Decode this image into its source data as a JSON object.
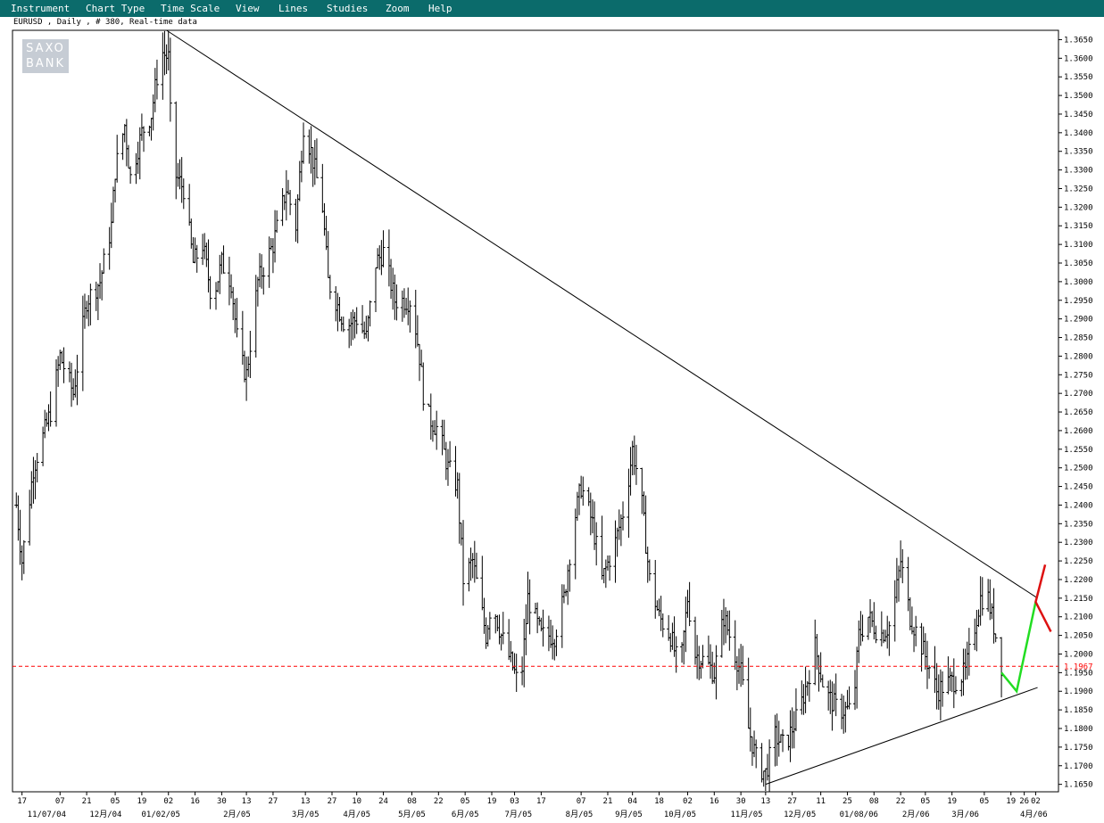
{
  "menu": [
    "Instrument",
    "Chart Type",
    "Time Scale",
    "View",
    "Lines",
    "Studies",
    "Zoom",
    "Help"
  ],
  "subtitle": "EURUSD , Daily , # 380, Real-time data",
  "logo": {
    "line1": "SAXO",
    "line2": "BANK"
  },
  "colors": {
    "menubar": "#0b6b6b",
    "up_arrow": "#22dd22",
    "down_arrow": "#dd1111",
    "price_line": "#ff0000"
  },
  "chart_data": {
    "type": "bar",
    "style": "ohlc",
    "instrument": "EURUSD",
    "timeframe": "Daily",
    "ylim": [
      1.163,
      1.3675
    ],
    "y_ticks": [
      "1.3650",
      "1.3600",
      "1.3550",
      "1.3500",
      "1.3450",
      "1.3400",
      "1.3350",
      "1.3300",
      "1.3250",
      "1.3200",
      "1.3150",
      "1.3100",
      "1.3050",
      "1.3000",
      "1.2950",
      "1.2900",
      "1.2850",
      "1.2800",
      "1.2750",
      "1.2700",
      "1.2650",
      "1.2600",
      "1.2550",
      "1.2500",
      "1.2450",
      "1.2400",
      "1.2350",
      "1.2300",
      "1.2250",
      "1.2200",
      "1.2150",
      "1.2100",
      "1.2050",
      "1.2000",
      "1.1950",
      "1.1900",
      "1.1850",
      "1.1800",
      "1.1750",
      "1.1700",
      "1.1650"
    ],
    "current_price": "1.1967",
    "x_day_ticks": [
      {
        "label": "17",
        "date": "2004-06-17"
      },
      {
        "label": "07",
        "date": "2004-07-07"
      },
      {
        "label": "21",
        "date": "2004-07-21"
      },
      {
        "label": "05",
        "date": "2004-08-05"
      },
      {
        "label": "19",
        "date": "2004-08-19"
      },
      {
        "label": "02",
        "date": "2004-09-02"
      },
      {
        "label": "16",
        "date": "2004-09-16"
      },
      {
        "label": "30",
        "date": "2004-09-30"
      },
      {
        "label": "13",
        "date": "2004-10-13"
      },
      {
        "label": "27",
        "date": "2004-10-27"
      },
      {
        "label": "13",
        "date": "2004-11-13"
      },
      {
        "label": "27",
        "date": "2004-11-27"
      },
      {
        "label": "10",
        "date": "2004-12-10"
      },
      {
        "label": "24",
        "date": "2004-12-24"
      },
      {
        "label": "08",
        "date": "2005-01-08"
      },
      {
        "label": "22",
        "date": "2005-01-22"
      },
      {
        "label": "05",
        "date": "2005-02-05"
      },
      {
        "label": "19",
        "date": "2005-02-19"
      },
      {
        "label": "03",
        "date": "2005-03-03"
      },
      {
        "label": "17",
        "date": "2005-03-17"
      },
      {
        "label": "07",
        "date": "2005-04-07"
      },
      {
        "label": "21",
        "date": "2005-04-21"
      },
      {
        "label": "04",
        "date": "2005-05-04"
      },
      {
        "label": "18",
        "date": "2005-05-18"
      },
      {
        "label": "02",
        "date": "2005-06-02"
      },
      {
        "label": "16",
        "date": "2005-06-16"
      },
      {
        "label": "30",
        "date": "2005-06-30"
      },
      {
        "label": "13",
        "date": "2005-07-13"
      },
      {
        "label": "27",
        "date": "2005-07-27"
      },
      {
        "label": "11",
        "date": "2005-08-11"
      },
      {
        "label": "25",
        "date": "2005-08-25"
      },
      {
        "label": "08",
        "date": "2005-09-08"
      },
      {
        "label": "22",
        "date": "2005-09-22"
      },
      {
        "label": "05",
        "date": "2005-10-05"
      },
      {
        "label": "19",
        "date": "2005-10-19"
      },
      {
        "label": "05",
        "date": "2005-11-05"
      },
      {
        "label": "19",
        "date": "2005-11-19"
      },
      {
        "label": "26",
        "date": "2005-11-26"
      },
      {
        "label": "02",
        "date": "2005-12-02"
      }
    ],
    "x_month_ticks": [
      {
        "label": "11/07/04",
        "date": "2004-06-30"
      },
      {
        "label": "12月/04",
        "date": "2004-07-31"
      },
      {
        "label": "01/02/05",
        "date": "2004-08-29"
      },
      {
        "label": "2月/05",
        "date": "2004-10-08"
      },
      {
        "label": "3月/05",
        "date": "2004-11-13"
      },
      {
        "label": "4月/05",
        "date": "2004-12-10"
      },
      {
        "label": "5月/05",
        "date": "2005-01-08"
      },
      {
        "label": "6月/05",
        "date": "2005-02-05"
      },
      {
        "label": "7月/05",
        "date": "2005-03-05"
      },
      {
        "label": "8月/05",
        "date": "2005-04-06"
      },
      {
        "label": "9月/05",
        "date": "2005-05-02"
      },
      {
        "label": "10月/05",
        "date": "2005-05-29"
      },
      {
        "label": "11月/05",
        "date": "2005-07-03"
      },
      {
        "label": "12月/05",
        "date": "2005-07-31"
      },
      {
        "label": "01/08/06",
        "date": "2005-08-31"
      },
      {
        "label": "2月/06",
        "date": "2005-09-30"
      },
      {
        "label": "3月/06",
        "date": "2005-10-26"
      },
      {
        "label": "4月/06",
        "date": "2005-12-01"
      }
    ],
    "anchors": [
      [
        "2004-06-14",
        1.24
      ],
      [
        "2004-06-17",
        1.225
      ],
      [
        "2004-06-23",
        1.25
      ],
      [
        "2004-07-02",
        1.265
      ],
      [
        "2004-07-07",
        1.28
      ],
      [
        "2004-07-14",
        1.27
      ],
      [
        "2004-07-21",
        1.295
      ],
      [
        "2004-07-28",
        1.3
      ],
      [
        "2004-08-03",
        1.315
      ],
      [
        "2004-08-05",
        1.33
      ],
      [
        "2004-08-10",
        1.342
      ],
      [
        "2004-08-13",
        1.328
      ],
      [
        "2004-08-19",
        1.34
      ],
      [
        "2004-08-24",
        1.345
      ],
      [
        "2004-08-29",
        1.362
      ],
      [
        "2004-09-02",
        1.36
      ],
      [
        "2004-09-04",
        1.33
      ],
      [
        "2004-09-10",
        1.325
      ],
      [
        "2004-09-15",
        1.305
      ],
      [
        "2004-09-20",
        1.31
      ],
      [
        "2004-09-25",
        1.295
      ],
      [
        "2004-09-30",
        1.305
      ],
      [
        "2004-10-05",
        1.3
      ],
      [
        "2004-10-09",
        1.28
      ],
      [
        "2004-10-13",
        1.275
      ],
      [
        "2004-10-19",
        1.3
      ],
      [
        "2004-10-27",
        1.31
      ],
      [
        "2004-11-03",
        1.325
      ],
      [
        "2004-11-08",
        1.315
      ],
      [
        "2004-11-12",
        1.342
      ],
      [
        "2004-11-16",
        1.335
      ],
      [
        "2004-11-22",
        1.32
      ],
      [
        "2004-11-25",
        1.3
      ],
      [
        "2004-11-29",
        1.295
      ],
      [
        "2004-12-04",
        1.288
      ],
      [
        "2004-12-10",
        1.29
      ],
      [
        "2004-12-15",
        1.285
      ],
      [
        "2004-12-20",
        1.305
      ],
      [
        "2004-12-24",
        1.308
      ],
      [
        "2004-12-30",
        1.295
      ],
      [
        "2005-01-08",
        1.295
      ],
      [
        "2005-01-12",
        1.28
      ],
      [
        "2005-01-15",
        1.265
      ],
      [
        "2005-01-22",
        1.26
      ],
      [
        "2005-01-27",
        1.25
      ],
      [
        "2005-02-01",
        1.245
      ],
      [
        "2005-02-04",
        1.22
      ],
      [
        "2005-02-09",
        1.225
      ],
      [
        "2005-02-16",
        1.205
      ],
      [
        "2005-02-19",
        1.215
      ],
      [
        "2005-02-24",
        1.205
      ],
      [
        "2005-03-03",
        1.195
      ],
      [
        "2005-03-06",
        1.19
      ],
      [
        "2005-03-10",
        1.215
      ],
      [
        "2005-03-17",
        1.205
      ],
      [
        "2005-03-24",
        1.205
      ],
      [
        "2005-03-29",
        1.215
      ],
      [
        "2005-04-03",
        1.235
      ],
      [
        "2005-04-07",
        1.245
      ],
      [
        "2005-04-13",
        1.235
      ],
      [
        "2005-04-18",
        1.22
      ],
      [
        "2005-04-25",
        1.23
      ],
      [
        "2005-04-30",
        1.24
      ],
      [
        "2005-05-04",
        1.255
      ],
      [
        "2005-05-08",
        1.245
      ],
      [
        "2005-05-13",
        1.22
      ],
      [
        "2005-05-18",
        1.21
      ],
      [
        "2005-05-24",
        1.205
      ],
      [
        "2005-05-29",
        1.195
      ],
      [
        "2005-06-02",
        1.215
      ],
      [
        "2005-06-06",
        1.2
      ],
      [
        "2005-06-11",
        1.198
      ],
      [
        "2005-06-16",
        1.195
      ],
      [
        "2005-06-21",
        1.21
      ],
      [
        "2005-06-27",
        1.2
      ],
      [
        "2005-06-30",
        1.195
      ],
      [
        "2005-07-04",
        1.18
      ],
      [
        "2005-07-09",
        1.17
      ],
      [
        "2005-07-13",
        1.168
      ],
      [
        "2005-07-18",
        1.178
      ],
      [
        "2005-07-23",
        1.175
      ],
      [
        "2005-07-31",
        1.185
      ],
      [
        "2005-08-05",
        1.195
      ],
      [
        "2005-08-08",
        1.202
      ],
      [
        "2005-08-13",
        1.19
      ],
      [
        "2005-08-20",
        1.185
      ],
      [
        "2005-08-28",
        1.185
      ],
      [
        "2005-08-31",
        1.205
      ],
      [
        "2005-09-05",
        1.21
      ],
      [
        "2005-09-11",
        1.205
      ],
      [
        "2005-09-17",
        1.208
      ],
      [
        "2005-09-20",
        1.218
      ],
      [
        "2005-09-22",
        1.225
      ],
      [
        "2005-09-27",
        1.21
      ],
      [
        "2005-10-01",
        1.205
      ],
      [
        "2005-10-06",
        1.198
      ],
      [
        "2005-10-11",
        1.19
      ],
      [
        "2005-10-16",
        1.192
      ],
      [
        "2005-10-21",
        1.193
      ],
      [
        "2005-10-26",
        1.195
      ],
      [
        "2005-10-30",
        1.205
      ],
      [
        "2005-11-03",
        1.215
      ],
      [
        "2005-11-07",
        1.215
      ],
      [
        "2005-11-11",
        1.205
      ],
      [
        "2005-11-14",
        1.197
      ]
    ],
    "trendlines": [
      {
        "from": [
          "2004-09-01",
          1.3675
        ],
        "to": [
          "2005-12-03",
          1.215
        ]
      },
      {
        "from": [
          "2005-07-13",
          1.165
        ],
        "to": [
          "2005-12-03",
          1.191
        ]
      }
    ],
    "annotations": [
      {
        "color": "green",
        "points": [
          [
            "2005-11-14",
            1.195
          ],
          [
            "2005-11-22",
            1.19
          ],
          [
            "2005-12-02",
            1.214
          ]
        ]
      },
      {
        "color": "red",
        "points": [
          [
            "2005-12-07",
            1.224
          ],
          [
            "2005-12-02",
            1.214
          ],
          [
            "2005-12-10",
            1.206
          ]
        ]
      }
    ]
  }
}
